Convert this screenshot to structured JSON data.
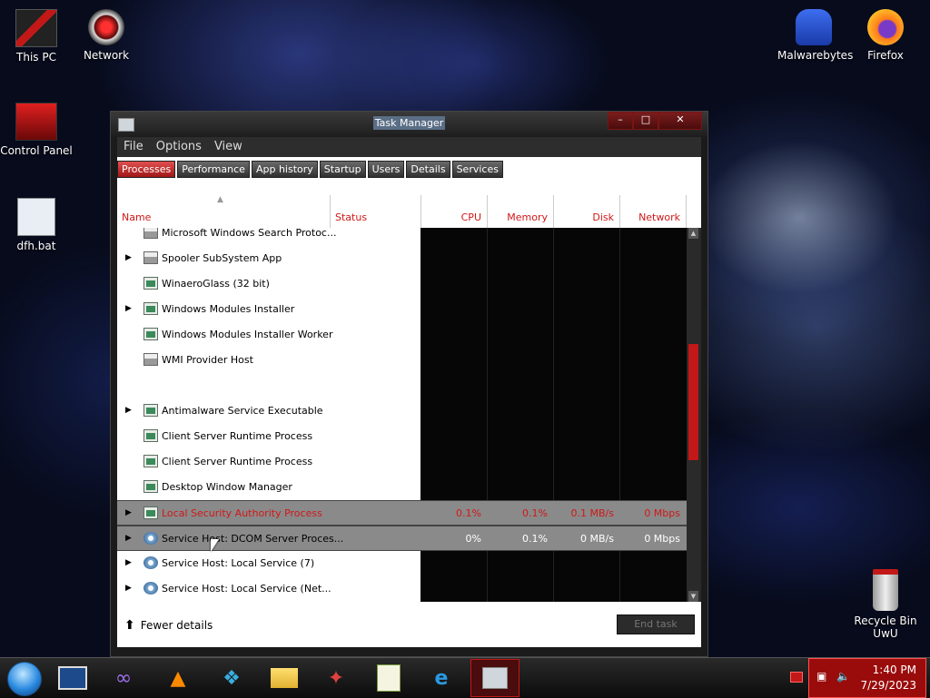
{
  "desktop": {
    "icons_left": [
      {
        "label": "This PC"
      },
      {
        "label": "Network"
      },
      {
        "label": "Control Panel"
      },
      {
        "label": "dfh.bat"
      }
    ],
    "icons_right": [
      {
        "label": "Malwarebytes"
      },
      {
        "label": "Firefox"
      },
      {
        "label": "Recycle Bin UwU"
      }
    ]
  },
  "window": {
    "title": "Task Manager",
    "menu": [
      "File",
      "Options",
      "View"
    ],
    "tabs": [
      "Processes",
      "Performance",
      "App history",
      "Startup",
      "Users",
      "Details",
      "Services"
    ],
    "active_tab": "Processes",
    "columns": {
      "name": "Name",
      "status": "Status",
      "cpu": "CPU",
      "memory": "Memory",
      "disk": "Disk",
      "network": "Network"
    },
    "rows": [
      {
        "name": "Microsoft Windows Search Protoc...",
        "expandable": false,
        "icon": "printer-icon"
      },
      {
        "name": "Spooler SubSystem App",
        "expandable": true,
        "icon": "printer-icon"
      },
      {
        "name": "WinaeroGlass (32 bit)",
        "expandable": false,
        "icon": "app-window-icon"
      },
      {
        "name": "Windows Modules Installer",
        "expandable": true,
        "icon": "app-window-icon"
      },
      {
        "name": "Windows Modules Installer Worker",
        "expandable": false,
        "icon": "app-window-icon"
      },
      {
        "name": "WMI Provider Host",
        "expandable": false,
        "icon": "printer-icon"
      },
      {
        "name": "",
        "expandable": false,
        "icon": ""
      },
      {
        "name": "Antimalware Service Executable",
        "expandable": true,
        "icon": "app-window-icon"
      },
      {
        "name": "Client Server Runtime Process",
        "expandable": false,
        "icon": "app-window-icon"
      },
      {
        "name": "Client Server Runtime Process",
        "expandable": false,
        "icon": "app-window-icon"
      },
      {
        "name": "Desktop Window Manager",
        "expandable": false,
        "icon": "app-window-icon"
      },
      {
        "name": "Local Security Authority Process",
        "expandable": true,
        "icon": "app-window-icon",
        "cpu": "0.1%",
        "memory": "0.1%",
        "disk": "0.1 MB/s",
        "network": "0 Mbps",
        "state": "highlighted"
      },
      {
        "name": "Service Host: DCOM Server Proces...",
        "expandable": true,
        "icon": "gear-icon",
        "cpu": "0%",
        "memory": "0.1%",
        "disk": "0 MB/s",
        "network": "0 Mbps",
        "state": "selected"
      },
      {
        "name": "Service Host: Local Service (7)",
        "expandable": true,
        "icon": "gear-icon"
      },
      {
        "name": "Service Host: Local Service (Net...",
        "expandable": true,
        "icon": "gear-icon"
      }
    ],
    "footer": {
      "fewer_details": "Fewer details",
      "end_task": "End task"
    }
  },
  "taskbar": {
    "clock_time": "1:40 PM",
    "clock_date": "7/29/2023"
  },
  "colors": {
    "accent": "#c21818",
    "window_bg": "#1b1b1b"
  }
}
